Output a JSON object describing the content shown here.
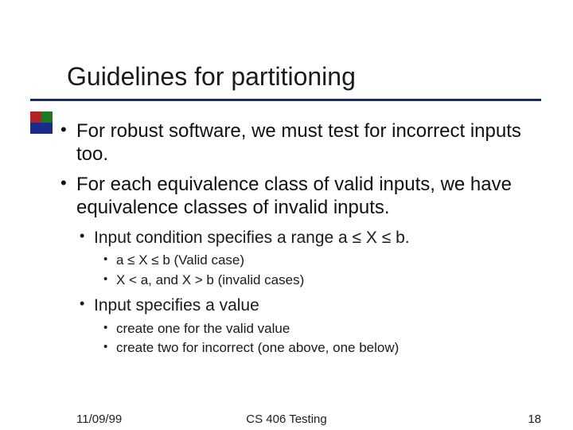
{
  "title": "Guidelines for partitioning",
  "bullets": {
    "b1": "For robust software, we must test for incorrect inputs too.",
    "b2": "For each equivalence class of valid inputs, we have equivalence classes of invalid inputs.",
    "b2_1": "Input condition specifies a range a ≤ X ≤ b.",
    "b2_1_1": "a ≤ X ≤ b (Valid case)",
    "b2_1_2": "X < a, and X > b (invalid cases)",
    "b2_2": "Input specifies a value",
    "b2_2_1": "create one for the valid value",
    "b2_2_2": "create two for incorrect (one above, one below)"
  },
  "footer": {
    "date": "11/09/99",
    "center": "CS 406 Testing",
    "page": "18"
  }
}
